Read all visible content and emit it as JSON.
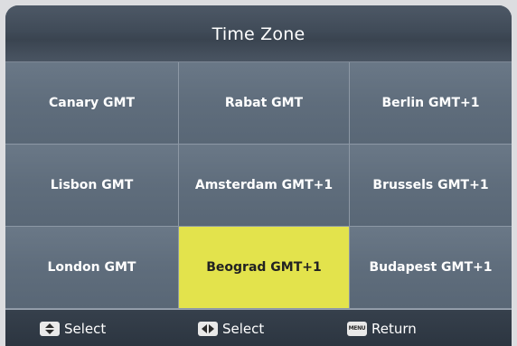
{
  "header": {
    "title": "Time Zone"
  },
  "grid": {
    "cells": [
      {
        "label": "Canary GMT"
      },
      {
        "label": "Rabat GMT"
      },
      {
        "label": "Berlin GMT+1"
      },
      {
        "label": "Lisbon GMT"
      },
      {
        "label": "Amsterdam GMT+1"
      },
      {
        "label": "Brussels GMT+1"
      },
      {
        "label": "London GMT"
      },
      {
        "label": "Beograd GMT+1"
      },
      {
        "label": "Budapest GMT+1"
      }
    ],
    "selected_label": "Beograd GMT+1",
    "highlight_color": "#e3e34c"
  },
  "footer": {
    "hints": [
      {
        "icon": "up-down-arrow-key-icon",
        "label": "Select"
      },
      {
        "icon": "left-right-arrow-key-icon",
        "label": "Select"
      },
      {
        "icon": "menu-key-icon",
        "icon_text": "MENU",
        "label": "Return"
      }
    ]
  }
}
